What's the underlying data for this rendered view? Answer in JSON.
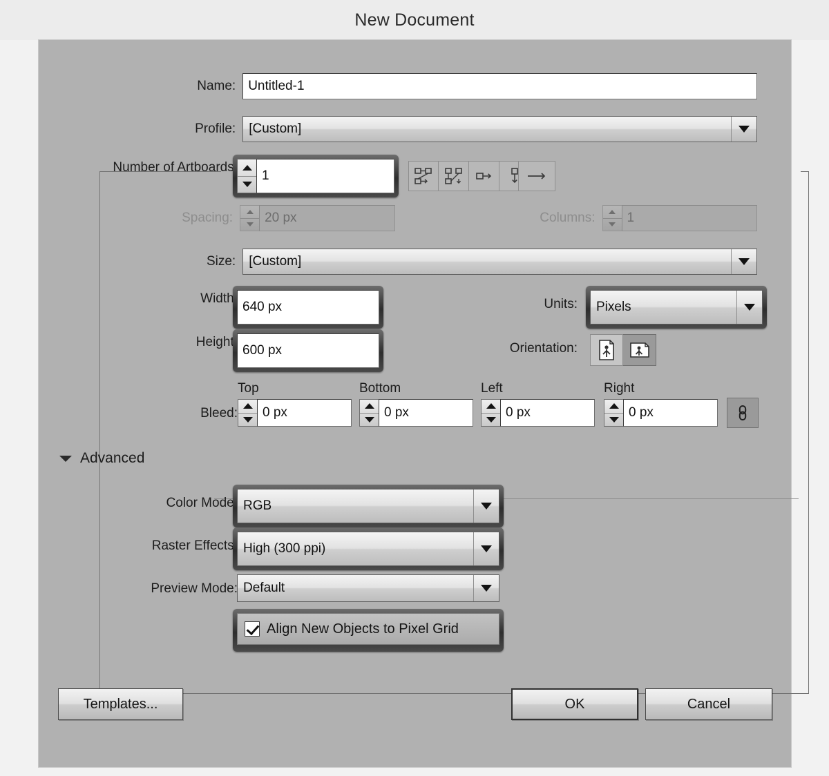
{
  "window": {
    "title": "New Document"
  },
  "fields": {
    "name_label": "Name:",
    "name_value": "Untitled-1",
    "profile_label": "Profile:",
    "profile_value": "[Custom]",
    "artboards_label": "Number of Artboards:",
    "artboards_value": "1",
    "spacing_label": "Spacing:",
    "spacing_value": "20 px",
    "columns_label": "Columns:",
    "columns_value": "1",
    "size_label": "Size:",
    "size_value": "[Custom]",
    "width_label": "Width:",
    "width_value": "640 px",
    "height_label": "Height:",
    "height_value": "600 px",
    "units_label": "Units:",
    "units_value": "Pixels",
    "orientation_label": "Orientation:"
  },
  "bleed": {
    "label": "Bleed:",
    "top_header": "Top",
    "bottom_header": "Bottom",
    "left_header": "Left",
    "right_header": "Right",
    "top_value": "0 px",
    "bottom_value": "0 px",
    "left_value": "0 px",
    "right_value": "0 px"
  },
  "advanced": {
    "section_label": "Advanced",
    "color_mode_label": "Color Mode:",
    "color_mode_value": "RGB",
    "raster_effects_label": "Raster Effects:",
    "raster_effects_value": "High (300 ppi)",
    "preview_mode_label": "Preview Mode:",
    "preview_mode_value": "Default",
    "align_pixel_grid_label": "Align New Objects to Pixel Grid",
    "align_pixel_grid_checked": true
  },
  "buttons": {
    "templates": "Templates...",
    "ok": "OK",
    "cancel": "Cancel"
  },
  "icons": {
    "arrange_grid_row": "arrange-by-row-icon",
    "arrange_grid_column": "arrange-by-column-icon",
    "arrange_single_row": "arrange-single-row-icon",
    "arrange_single_column": "arrange-single-column-icon",
    "flow_direction": "left-to-right-flow-icon",
    "orientation_portrait": "portrait-icon",
    "orientation_landscape": "landscape-icon",
    "bleed_link": "link-chain-icon"
  },
  "colors": {
    "dialog_background": "#b1b1b1",
    "titlebar_background": "#ececec",
    "field_background": "#ffffff",
    "focus_ring": "#2d2d2d",
    "disabled_text": "#8d8d8d"
  }
}
